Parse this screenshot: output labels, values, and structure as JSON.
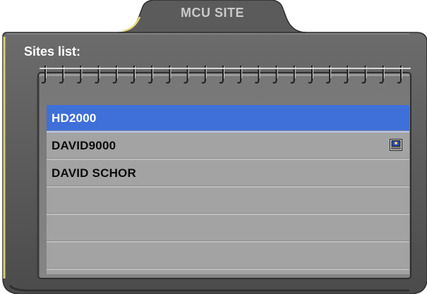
{
  "window": {
    "title": "MCU SITE",
    "list_label": "Sites list:"
  },
  "sites": [
    {
      "name": "HD2000",
      "selected": true,
      "icon": null
    },
    {
      "name": "DAVID9000",
      "selected": false,
      "icon": "monitor-icon"
    },
    {
      "name": "DAVID SCHOR",
      "selected": false,
      "icon": null
    },
    {
      "name": "",
      "selected": false,
      "icon": null
    },
    {
      "name": "",
      "selected": false,
      "icon": null
    },
    {
      "name": "",
      "selected": false,
      "icon": null
    }
  ],
  "colors": {
    "frame_dark": "#4a4a4a",
    "frame_light": "#6a6a6a",
    "panel": "#7d7d7d",
    "list_bg": "#a3a3a3",
    "selection": "#3f6fd9",
    "accent_edge": "#e8e27a"
  }
}
